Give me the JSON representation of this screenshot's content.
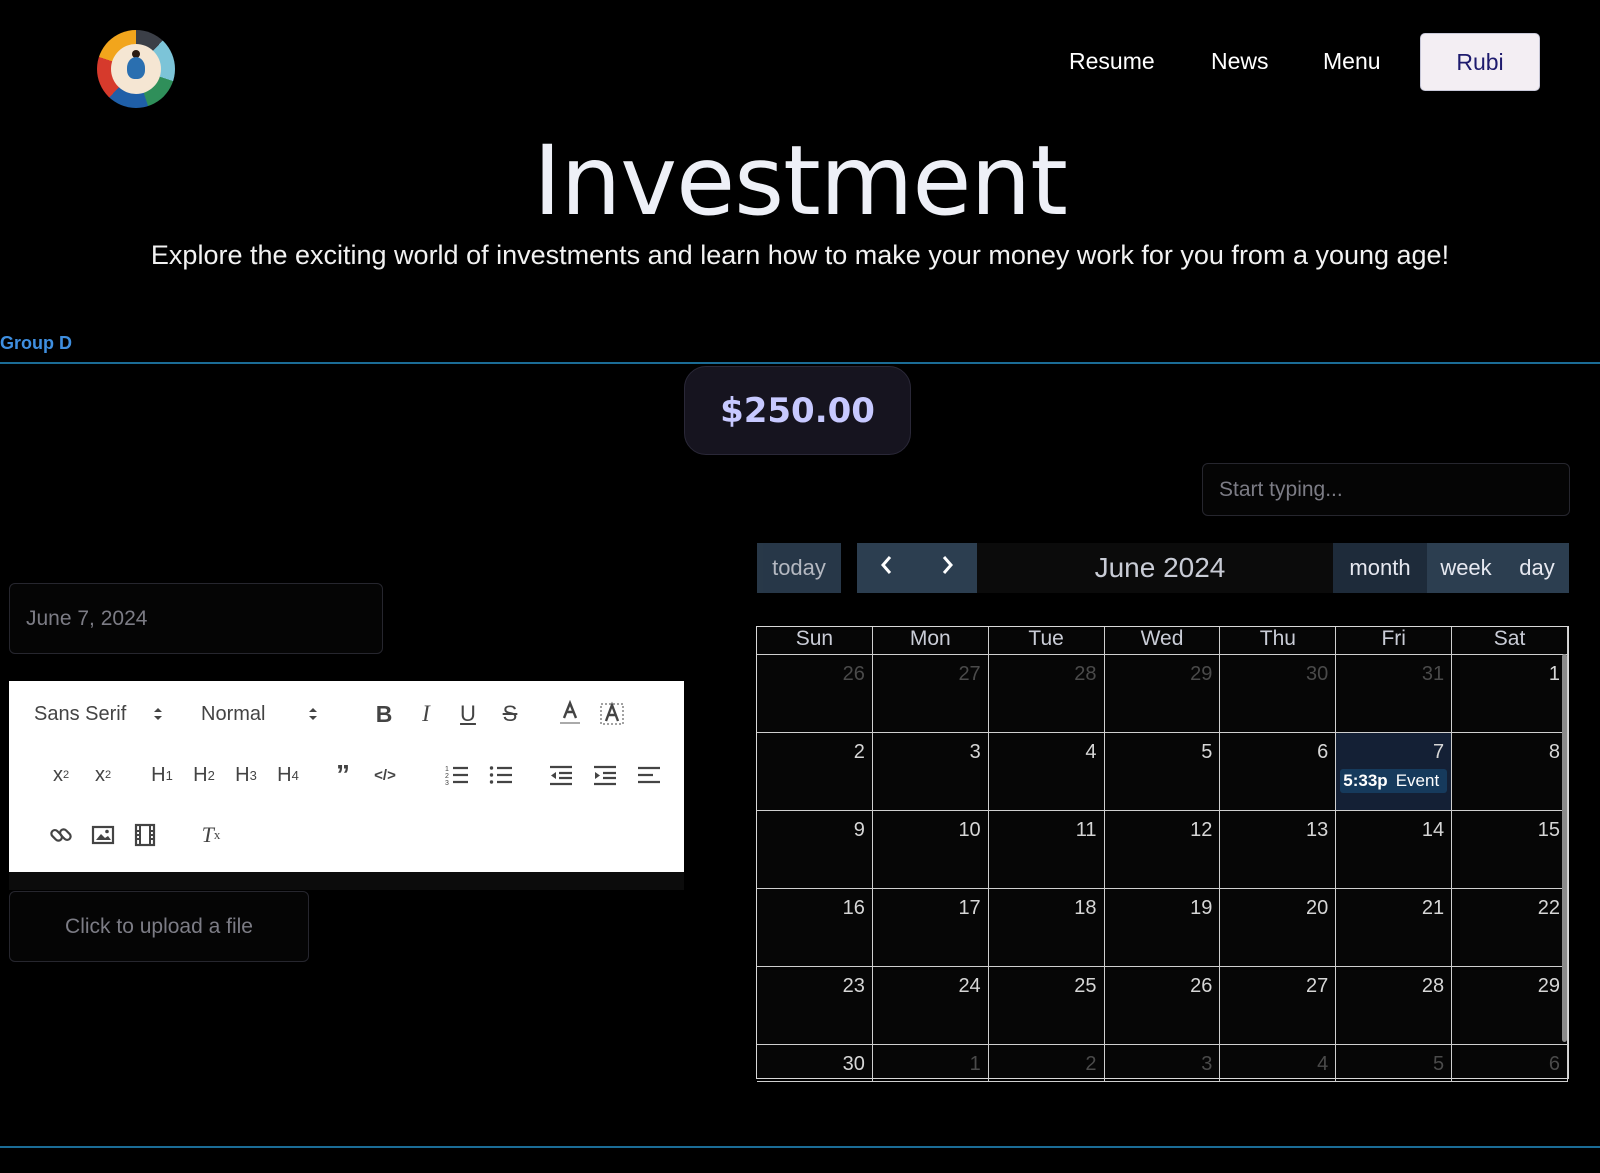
{
  "header": {
    "nav": [
      "Resume",
      "News",
      "Menu"
    ],
    "user_button": "Rubi"
  },
  "hero": {
    "title": "Investment",
    "subtitle": "Explore the exciting world of investments and learn how to make your money work for you from a young age!"
  },
  "group_label": "Group D",
  "price": "$250.00",
  "search": {
    "placeholder": "Start typing..."
  },
  "date_field": {
    "value": "June 7, 2024"
  },
  "editor": {
    "font": "Sans Serif",
    "size": "Normal"
  },
  "upload": {
    "label": "Click to upload a file"
  },
  "calendar": {
    "today_label": "today",
    "title": "June 2024",
    "views": [
      "month",
      "week",
      "day"
    ],
    "weekdays": [
      "Sun",
      "Mon",
      "Tue",
      "Wed",
      "Thu",
      "Fri",
      "Sat"
    ],
    "weeks": [
      [
        "26",
        "27",
        "28",
        "29",
        "30",
        "31",
        "1"
      ],
      [
        "2",
        "3",
        "4",
        "5",
        "6",
        "7",
        "8"
      ],
      [
        "9",
        "10",
        "11",
        "12",
        "13",
        "14",
        "15"
      ],
      [
        "16",
        "17",
        "18",
        "19",
        "20",
        "21",
        "22"
      ],
      [
        "23",
        "24",
        "25",
        "26",
        "27",
        "28",
        "29"
      ],
      [
        "30",
        "1",
        "2",
        "3",
        "4",
        "5",
        "6"
      ]
    ],
    "event": {
      "time": "5:33p",
      "title": "Event"
    },
    "colors": {
      "button": "#2c3e50",
      "today_cell": "#142035",
      "event": "#163a5c"
    }
  }
}
